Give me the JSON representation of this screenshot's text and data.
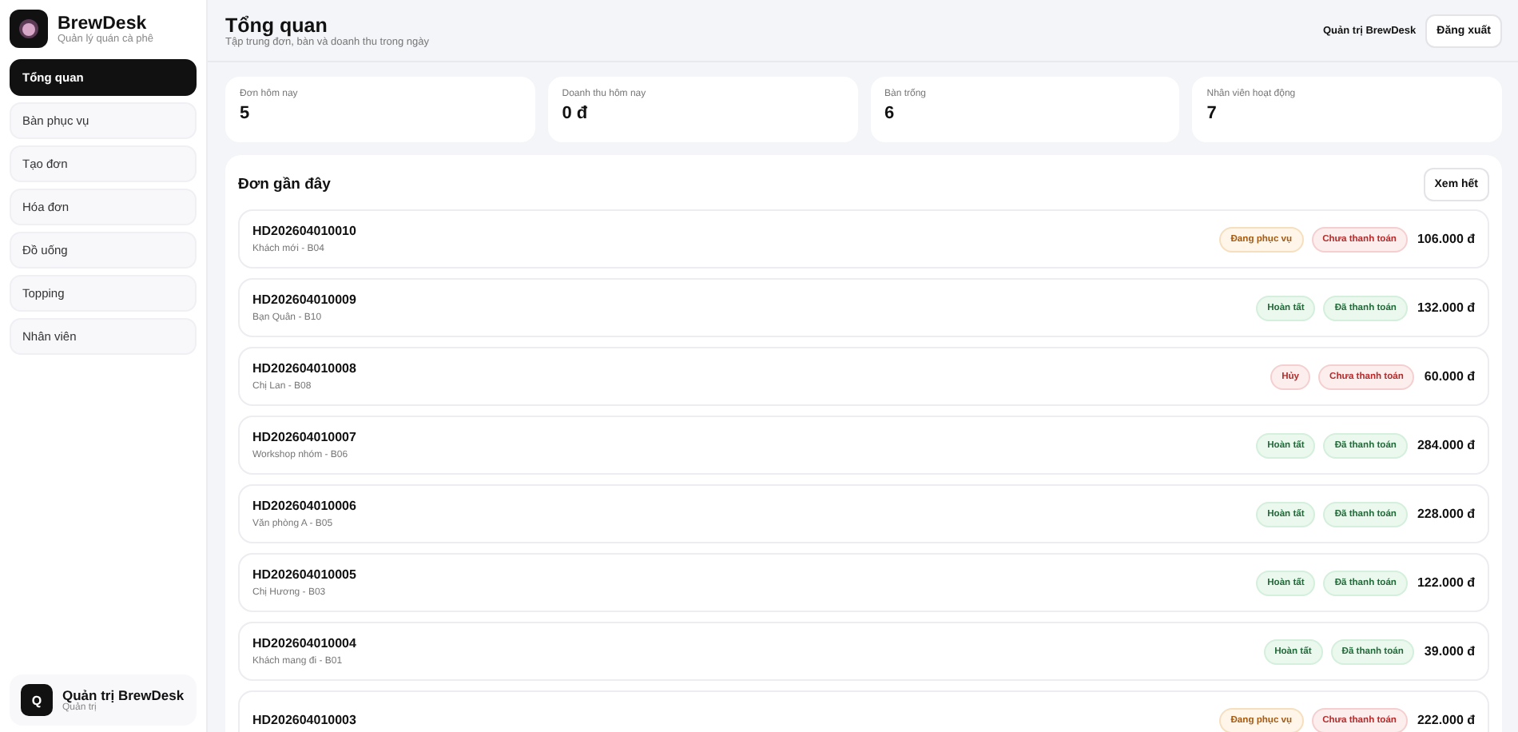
{
  "brand": {
    "name": "BrewDesk",
    "tagline": "Quản lý quán cà phê"
  },
  "nav": [
    {
      "label": "Tổng quan",
      "selected": true
    },
    {
      "label": "Bàn phục vụ",
      "selected": false
    },
    {
      "label": "Tạo đơn",
      "selected": false
    },
    {
      "label": "Hóa đơn",
      "selected": false
    },
    {
      "label": "Đồ uống",
      "selected": false
    },
    {
      "label": "Topping",
      "selected": false
    },
    {
      "label": "Nhân viên",
      "selected": false
    }
  ],
  "user": {
    "initial": "Q",
    "name": "Quản trị BrewDesk",
    "role": "Quản trị"
  },
  "header": {
    "title": "Tổng quan",
    "subtitle": "Tập trung đơn, bàn và doanh thu trong ngày",
    "user": "Quản trị BrewDesk",
    "logout": "Đăng xuất"
  },
  "stats": [
    {
      "label": "Đơn hôm nay",
      "value": "5"
    },
    {
      "label": "Doanh thu hôm nay",
      "value": "0 đ"
    },
    {
      "label": "Bàn trống",
      "value": "6"
    },
    {
      "label": "Nhân viên hoạt động",
      "value": "7"
    }
  ],
  "recent": {
    "title": "Đơn gần đây",
    "view_all": "Xem hết",
    "orders": [
      {
        "code": "HD202604010010",
        "detail": "Khách mới - B04",
        "badges": [
          {
            "kind": "warn",
            "text": "Đang phục vụ"
          },
          {
            "kind": "bad",
            "text": "Chưa thanh toán"
          }
        ],
        "total": "106.000 đ"
      },
      {
        "code": "HD202604010009",
        "detail": "Bạn Quân - B10",
        "badges": [
          {
            "kind": "good",
            "text": "Hoàn tất"
          },
          {
            "kind": "good",
            "text": "Đã thanh toán"
          }
        ],
        "total": "132.000 đ"
      },
      {
        "code": "HD202604010008",
        "detail": "Chị Lan - B08",
        "badges": [
          {
            "kind": "bad",
            "text": "Hủy"
          },
          {
            "kind": "bad",
            "text": "Chưa thanh toán"
          }
        ],
        "total": "60.000 đ"
      },
      {
        "code": "HD202604010007",
        "detail": "Workshop nhóm - B06",
        "badges": [
          {
            "kind": "good",
            "text": "Hoàn tất"
          },
          {
            "kind": "good",
            "text": "Đã thanh toán"
          }
        ],
        "total": "284.000 đ"
      },
      {
        "code": "HD202604010006",
        "detail": "Văn phòng A - B05",
        "badges": [
          {
            "kind": "good",
            "text": "Hoàn tất"
          },
          {
            "kind": "good",
            "text": "Đã thanh toán"
          }
        ],
        "total": "228.000 đ"
      },
      {
        "code": "HD202604010005",
        "detail": "Chị Hương - B03",
        "badges": [
          {
            "kind": "good",
            "text": "Hoàn tất"
          },
          {
            "kind": "good",
            "text": "Đã thanh toán"
          }
        ],
        "total": "122.000 đ"
      },
      {
        "code": "HD202604010004",
        "detail": "Khách mang đi - B01",
        "badges": [
          {
            "kind": "good",
            "text": "Hoàn tất"
          },
          {
            "kind": "good",
            "text": "Đã thanh toán"
          }
        ],
        "total": "39.000 đ"
      },
      {
        "code": "HD202604010003",
        "badges": [
          {
            "kind": "warn",
            "text": "Đang phục vụ"
          },
          {
            "kind": "bad",
            "text": "Chưa thanh toán"
          }
        ],
        "total": "222.000 đ"
      }
    ]
  }
}
